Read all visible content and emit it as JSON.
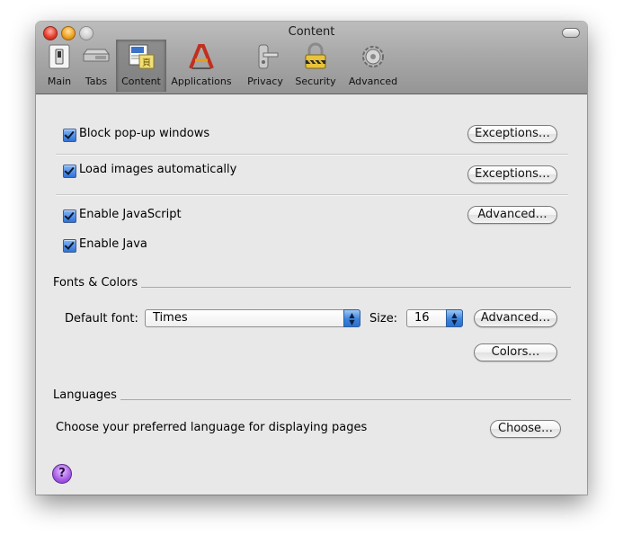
{
  "window": {
    "title": "Content"
  },
  "toolbar": {
    "items": [
      {
        "label": "Main",
        "icon": "switch-icon"
      },
      {
        "label": "Tabs",
        "icon": "tabs-icon"
      },
      {
        "label": "Content",
        "icon": "content-icon",
        "selected": true
      },
      {
        "label": "Applications",
        "icon": "applications-icon"
      },
      {
        "label": "Privacy",
        "icon": "privacy-icon"
      },
      {
        "label": "Security",
        "icon": "lock-icon"
      },
      {
        "label": "Advanced",
        "icon": "gear-icon"
      }
    ]
  },
  "content": {
    "block_popups": {
      "label": "Block pop-up windows",
      "checked": true,
      "button": "Exceptions…"
    },
    "load_images": {
      "label": "Load images automatically",
      "checked": true,
      "button": "Exceptions…"
    },
    "enable_javascript": {
      "label": "Enable JavaScript",
      "checked": true,
      "button": "Advanced…"
    },
    "enable_java": {
      "label": "Enable Java",
      "checked": true
    }
  },
  "fonts_colors": {
    "heading": "Fonts & Colors",
    "default_font_label": "Default font:",
    "default_font_value": "Times",
    "size_label": "Size:",
    "size_value": "16",
    "advanced_button": "Advanced…",
    "colors_button": "Colors…"
  },
  "languages": {
    "heading": "Languages",
    "description": "Choose your preferred language for displaying pages",
    "choose_button": "Choose…"
  },
  "help": {
    "symbol": "?"
  },
  "colors": {
    "accent": "#2f73d8",
    "window_bg": "#e8e8e8",
    "titlebar": "#a9a9a9"
  }
}
